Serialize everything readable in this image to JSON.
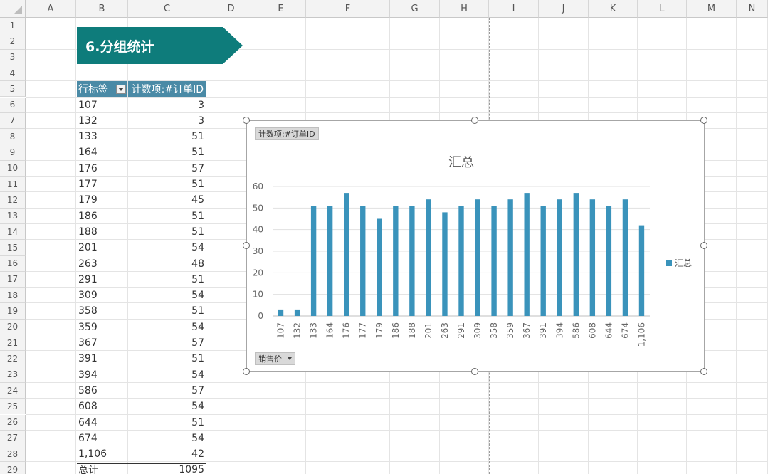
{
  "columns": [
    "A",
    "B",
    "C",
    "D",
    "E",
    "F",
    "G",
    "H",
    "I",
    "J",
    "K",
    "L",
    "M",
    "N"
  ],
  "rows": [
    "1",
    "2",
    "3",
    "4",
    "5",
    "6",
    "7",
    "8",
    "9",
    "10",
    "11",
    "12",
    "13",
    "14",
    "15",
    "16",
    "17",
    "18",
    "19",
    "20",
    "21",
    "22",
    "23",
    "24",
    "25",
    "26",
    "27",
    "28",
    "29"
  ],
  "title_banner": "6.分组统计",
  "pivot": {
    "row_label_header": "行标签",
    "value_header": "计数项:#订单ID",
    "rows": [
      {
        "label": "107",
        "count": "3"
      },
      {
        "label": "132",
        "count": "3"
      },
      {
        "label": "133",
        "count": "51"
      },
      {
        "label": "164",
        "count": "51"
      },
      {
        "label": "176",
        "count": "57"
      },
      {
        "label": "177",
        "count": "51"
      },
      {
        "label": "179",
        "count": "45"
      },
      {
        "label": "186",
        "count": "51"
      },
      {
        "label": "188",
        "count": "51"
      },
      {
        "label": "201",
        "count": "54"
      },
      {
        "label": "263",
        "count": "48"
      },
      {
        "label": "291",
        "count": "51"
      },
      {
        "label": "309",
        "count": "54"
      },
      {
        "label": "358",
        "count": "51"
      },
      {
        "label": "359",
        "count": "54"
      },
      {
        "label": "367",
        "count": "57"
      },
      {
        "label": "391",
        "count": "51"
      },
      {
        "label": "394",
        "count": "54"
      },
      {
        "label": "586",
        "count": "57"
      },
      {
        "label": "608",
        "count": "54"
      },
      {
        "label": "644",
        "count": "51"
      },
      {
        "label": "674",
        "count": "54"
      },
      {
        "label": "1,106",
        "count": "42"
      }
    ],
    "total_label": "总计",
    "total_value": "1095"
  },
  "chart_field_value": "计数项:#订单ID",
  "chart_field_axis": "销售价",
  "chart_data": {
    "type": "bar",
    "title": "汇总",
    "categories": [
      "107",
      "132",
      "133",
      "164",
      "176",
      "177",
      "179",
      "186",
      "188",
      "201",
      "263",
      "291",
      "309",
      "358",
      "359",
      "367",
      "391",
      "394",
      "586",
      "608",
      "644",
      "674",
      "1,106"
    ],
    "series": [
      {
        "name": "汇总",
        "values": [
          3,
          3,
          51,
          51,
          57,
          51,
          45,
          51,
          51,
          54,
          48,
          51,
          54,
          51,
          54,
          57,
          51,
          54,
          57,
          54,
          51,
          54,
          42
        ]
      }
    ],
    "ylim": [
      0,
      60
    ],
    "yticks": [
      0,
      10,
      20,
      30,
      40,
      50,
      60
    ],
    "grid": true,
    "legend": "right",
    "bar_color": "#3a93bb"
  }
}
